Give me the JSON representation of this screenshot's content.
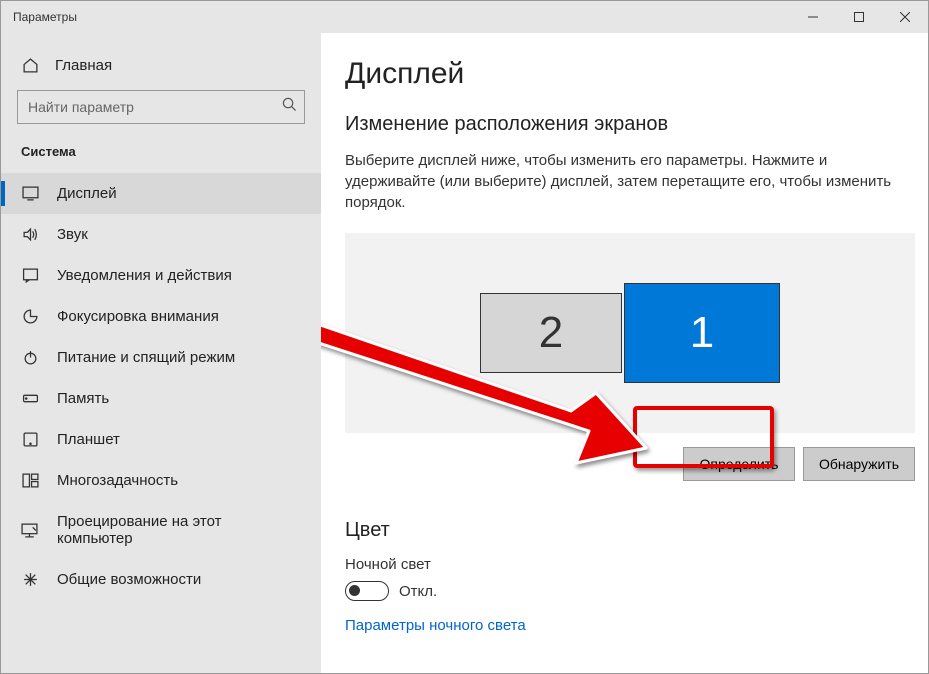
{
  "window": {
    "title": "Параметры"
  },
  "sidebar": {
    "home": "Главная",
    "search_placeholder": "Найти параметр",
    "section": "Система",
    "items": [
      {
        "label": "Дисплей",
        "active": true
      },
      {
        "label": "Звук"
      },
      {
        "label": "Уведомления и действия"
      },
      {
        "label": "Фокусировка внимания"
      },
      {
        "label": "Питание и спящий режим"
      },
      {
        "label": "Память"
      },
      {
        "label": "Планшет"
      },
      {
        "label": "Многозадачность"
      },
      {
        "label": "Проецирование на этот компьютер"
      },
      {
        "label": "Общие возможности"
      }
    ]
  },
  "main": {
    "title": "Дисплей",
    "arrange_heading": "Изменение расположения экранов",
    "arrange_desc": "Выберите дисплей ниже, чтобы изменить его параметры. Нажмите и удерживайте (или выберите) дисплей, затем перетащите его, чтобы изменить порядок.",
    "display2": "2",
    "display1": "1",
    "identify_btn": "Определить",
    "detect_btn": "Обнаружить",
    "color_heading": "Цвет",
    "night_light_label": "Ночной свет",
    "toggle_state": "Откл.",
    "night_light_link": "Параметры ночного света"
  }
}
